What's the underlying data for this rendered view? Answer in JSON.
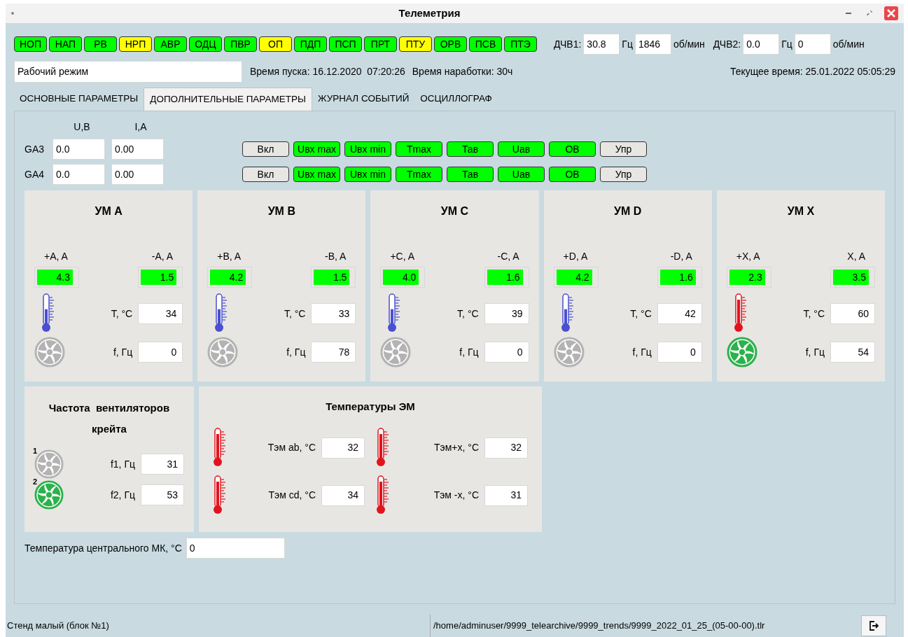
{
  "window": {
    "title": "Телеметрия"
  },
  "indicators": [
    {
      "label": "НОП",
      "color": "#00ff00"
    },
    {
      "label": "НАП",
      "color": "#00ff00"
    },
    {
      "label": "РВ",
      "color": "#00ff00"
    },
    {
      "label": "НРП",
      "color": "#ffff00"
    },
    {
      "label": "АВР",
      "color": "#00ff00"
    },
    {
      "label": "ОДЦ",
      "color": "#00ff00"
    },
    {
      "label": "ПВР",
      "color": "#00ff00"
    },
    {
      "label": "ОП",
      "color": "#ffff00"
    },
    {
      "label": "ПДП",
      "color": "#00ff00"
    },
    {
      "label": "ПСП",
      "color": "#00ff00"
    },
    {
      "label": "ПРТ",
      "color": "#00ff00"
    },
    {
      "label": "ПТУ",
      "color": "#ffff00"
    },
    {
      "label": "ОРВ",
      "color": "#00ff00"
    },
    {
      "label": "ПСВ",
      "color": "#00ff00"
    },
    {
      "label": "ПТЭ",
      "color": "#00ff00"
    }
  ],
  "sensors": [
    {
      "label": "ДЧВ1:",
      "freq": "30.8",
      "freq_unit": "Гц",
      "rpm": "1846",
      "rpm_unit": "об/мин"
    },
    {
      "label": "ДЧВ2:",
      "freq": "0.0",
      "freq_unit": "Гц",
      "rpm": "0",
      "rpm_unit": "об/мин"
    }
  ],
  "mode": "Рабочий режим",
  "start_time": "Время пуска: 16.12.2020  07:20:26",
  "run_time": "Время наработки: 30ч",
  "current_time": "Текущее время: 25.01.2022 05:05:29",
  "tabs": [
    {
      "label": "ОСНОВНЫЕ ПАРАМЕТРЫ",
      "selected": false
    },
    {
      "label": "ДОПОЛНИТЕЛЬНЫЕ ПАРАМЕТРЫ",
      "selected": true
    },
    {
      "label": "ЖУРНАЛ СОБЫТИЙ",
      "selected": false
    },
    {
      "label": "ОСЦИЛЛОГРАФ",
      "selected": false
    }
  ],
  "ga": {
    "columns": [
      "U,В",
      "I,А"
    ],
    "rows": [
      {
        "label": "GA3",
        "u": "0.0",
        "i": "0.00",
        "flags": [
          {
            "label": "Вкл",
            "on": false
          },
          {
            "label": "Uвх max",
            "on": true
          },
          {
            "label": "Uвх min",
            "on": true
          },
          {
            "label": "Tmax",
            "on": true
          },
          {
            "label": "Тав",
            "on": true
          },
          {
            "label": "Uав",
            "on": true
          },
          {
            "label": "ОВ",
            "on": true
          },
          {
            "label": "Упр",
            "on": false
          }
        ]
      },
      {
        "label": "GA4",
        "u": "0.0",
        "i": "0.00",
        "flags": [
          {
            "label": "Вкл",
            "on": false
          },
          {
            "label": "Uвх max",
            "on": true
          },
          {
            "label": "Uвх min",
            "on": true
          },
          {
            "label": "Tmax",
            "on": true
          },
          {
            "label": "Тав",
            "on": true
          },
          {
            "label": "Uав",
            "on": true
          },
          {
            "label": "ОВ",
            "on": true
          },
          {
            "label": "Упр",
            "on": false
          }
        ]
      }
    ]
  },
  "modules": [
    {
      "title": "УМ A",
      "plus_label": "+A, A",
      "plus": "4.3",
      "plus_ok": true,
      "minus_label": "-A, A",
      "minus": "1.5",
      "minus_ok": true,
      "temp_label": "T, °C",
      "temp": "34",
      "thermometer": {
        "kind": "cold"
      },
      "fan_label": "f, Гц",
      "fan": "0",
      "fan_on": false
    },
    {
      "title": "УМ B",
      "plus_label": "+B, A",
      "plus": "4.2",
      "plus_ok": true,
      "minus_label": "-B, A",
      "minus": "1.5",
      "minus_ok": true,
      "temp_label": "T, °C",
      "temp": "33",
      "thermometer": {
        "kind": "cold"
      },
      "fan_label": "f, Гц",
      "fan": "78",
      "fan_on": false
    },
    {
      "title": "УМ C",
      "plus_label": "+C, A",
      "plus": "4.0",
      "plus_ok": true,
      "minus_label": "-C, A",
      "minus": "1.6",
      "minus_ok": true,
      "temp_label": "T, °C",
      "temp": "39",
      "thermometer": {
        "kind": "cold"
      },
      "fan_label": "f, Гц",
      "fan": "0",
      "fan_on": false
    },
    {
      "title": "УМ D",
      "plus_label": "+D, A",
      "plus": "4.2",
      "plus_ok": true,
      "minus_label": "-D, A",
      "minus": "1.6",
      "minus_ok": true,
      "temp_label": "T, °C",
      "temp": "42",
      "thermometer": {
        "kind": "cold"
      },
      "fan_label": "f, Гц",
      "fan": "0",
      "fan_on": false
    },
    {
      "title": "УМ X",
      "plus_label": "+X, A",
      "plus": "2.3",
      "plus_ok": true,
      "minus_label": "X, A",
      "minus": "3.5",
      "minus_ok": true,
      "temp_label": "T, °C",
      "temp": "60",
      "thermometer": {
        "kind": "hot"
      },
      "fan_label": "f, Гц",
      "fan": "54",
      "fan_on": true
    }
  ],
  "crate_fans": {
    "title": "Частота  вентиляторов крейта",
    "fans": [
      {
        "number": "1",
        "label": "f1, Гц",
        "value": "31",
        "on": false
      },
      {
        "number": "2",
        "label": "f2, Гц",
        "value": "53",
        "on": true
      }
    ]
  },
  "em_temps": {
    "title": "Температуры ЭМ",
    "items": [
      {
        "label": "Тэм ab, °C",
        "value": "32",
        "thermometer": {
          "kind": "hot"
        }
      },
      {
        "label": "Тэм+x, °C",
        "value": "32",
        "thermometer": {
          "kind": "hot"
        }
      },
      {
        "label": "Тэм cd, °C",
        "value": "34",
        "thermometer": {
          "kind": "hot"
        }
      },
      {
        "label": "Тэм -x, °C",
        "value": "31",
        "thermometer": {
          "kind": "hot"
        }
      }
    ]
  },
  "mk_temp": {
    "label": "Температура центрального МК, °C",
    "value": "0"
  },
  "status_bar": {
    "stand": "Стенд малый (блок №1)",
    "file": "/home/adminuser/9999_telearchive/9999_trends/9999_2022_01_25_(05-00-00).tlr"
  }
}
